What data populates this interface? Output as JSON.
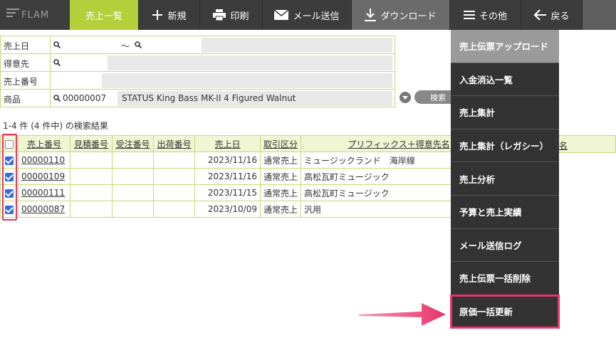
{
  "app": {
    "logo": "FLAM"
  },
  "nav": {
    "sales_list": "売上一覧",
    "new": "新規",
    "print": "印刷",
    "email": "メール送信",
    "download": "ダウンロード",
    "other": "その他",
    "back": "戻る"
  },
  "search": {
    "date_label": "売上日",
    "date_sep": "～",
    "customer_label": "得意先",
    "number_label": "売上番号",
    "product_label": "商品",
    "product_code": "00000007",
    "product_name": "STATUS King Bass MK-II 4 Figured Walnut",
    "search_button": "検索"
  },
  "results": {
    "summary": "1-4 件 (4 件中) の検索結果",
    "columns": [
      "売上番号",
      "見積番号",
      "受注番号",
      "出荷番号",
      "売上日",
      "取引区分",
      "プリフィックス＋得意先名"
    ],
    "col_tail": "名",
    "rows": [
      {
        "no": "00000110",
        "date": "2023/11/16",
        "type": "通常売上",
        "customer": "ミュージックランド　海岸線"
      },
      {
        "no": "00000109",
        "date": "2023/11/16",
        "type": "通常売上",
        "customer": "高松瓦町ミュージック"
      },
      {
        "no": "00000111",
        "date": "2023/11/15",
        "type": "通常売上",
        "customer": "高松瓦町ミュージック"
      },
      {
        "no": "00000087",
        "date": "2023/10/09",
        "type": "通常売上",
        "customer": "汎用"
      }
    ]
  },
  "menu": {
    "items": [
      "売上伝票アップロード",
      "入金消込一覧",
      "売上集計",
      "売上集計（レガシー）",
      "売上分析",
      "予算と売上実績",
      "メール送信ログ",
      "売上伝票一括削除",
      "原価一括更新"
    ]
  },
  "colors": {
    "accent": "#b5cf3a",
    "highlight": "#e8336b",
    "menu_bg": "#333333",
    "checkbox": "#2f6de0"
  }
}
